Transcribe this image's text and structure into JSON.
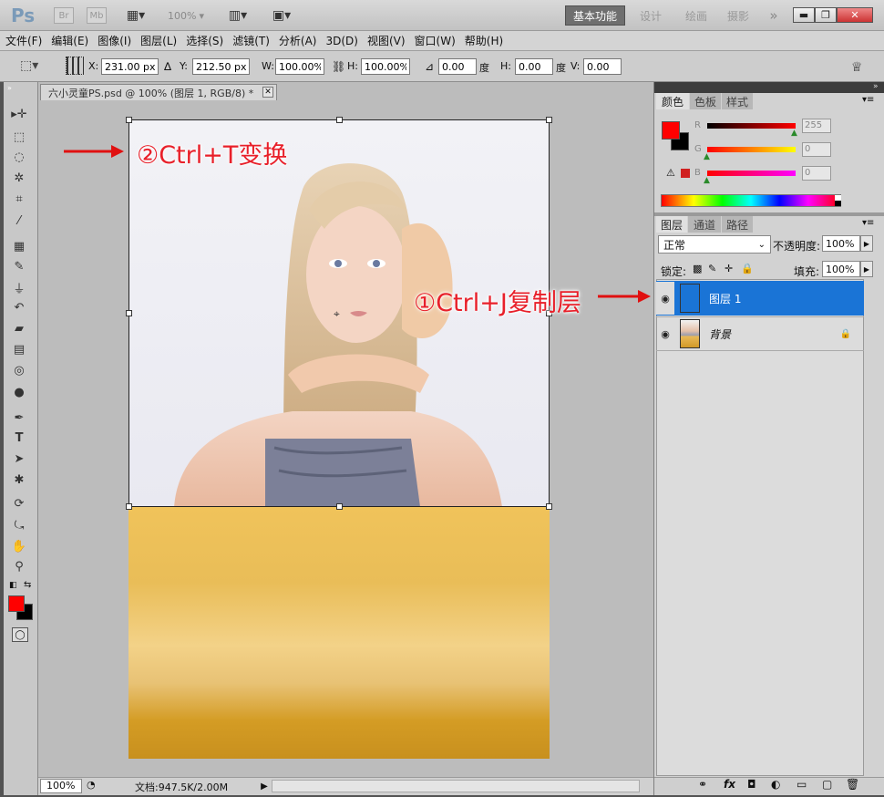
{
  "app": {
    "logo": "Ps",
    "bridge": "Br",
    "minibridge": "Mb",
    "zoom": "100%"
  },
  "workspaces": [
    "基本功能",
    "设计",
    "绘画",
    "摄影"
  ],
  "window_buttons": {
    "minimize": "▬",
    "restore": "❐",
    "close": "✕"
  },
  "menu": [
    "文件(F)",
    "编辑(E)",
    "图像(I)",
    "图层(L)",
    "选择(S)",
    "滤镜(T)",
    "分析(A)",
    "3D(D)",
    "视图(V)",
    "窗口(W)",
    "帮助(H)"
  ],
  "options": {
    "x_label": "X:",
    "x": "231.00 px",
    "y_label": "Y:",
    "y": "212.50 px",
    "w_label": "W:",
    "w": "100.00%",
    "h_label": "H:",
    "h": "100.00%",
    "rot": "0.00",
    "deg1": "度",
    "hskew_label": "H:",
    "hskew": "0.00",
    "deg2": "度",
    "vskew_label": "V:",
    "vskew": "0.00"
  },
  "document": {
    "tab": "六小灵童PS.psd @ 100% (图层 1, RGB/8) *",
    "close": "✕"
  },
  "annotations": {
    "transform": "②Ctrl+T变换",
    "duplicate": "①Ctrl+J复制层"
  },
  "status": {
    "zoom": "100%",
    "doc": "文档:947.5K/2.00M"
  },
  "color_panel": {
    "tabs": [
      "颜色",
      "色板",
      "样式"
    ],
    "channels": [
      {
        "label": "R",
        "value": "255",
        "color": "#e00000"
      },
      {
        "label": "G",
        "value": "0",
        "color": "#e8c800"
      },
      {
        "label": "B",
        "value": "0",
        "color": "#d000c0"
      }
    ],
    "foreground": "#ff0000",
    "background": "#000000"
  },
  "layers_panel": {
    "tabs": [
      "图层",
      "通道",
      "路径"
    ],
    "blend_mode": "正常",
    "opacity_label": "不透明度:",
    "opacity": "100%",
    "lock_label": "锁定:",
    "fill_label": "填充:",
    "fill": "100%",
    "layers": [
      {
        "name": "图层 1",
        "selected": true
      },
      {
        "name": "背景",
        "selected": false,
        "locked": true
      }
    ]
  },
  "bottom_icons": [
    "link-icon",
    "fx-icon",
    "mask-icon",
    "adjustment-icon",
    "folder-icon",
    "new-layer-icon",
    "trash-icon"
  ],
  "fx": "fx"
}
